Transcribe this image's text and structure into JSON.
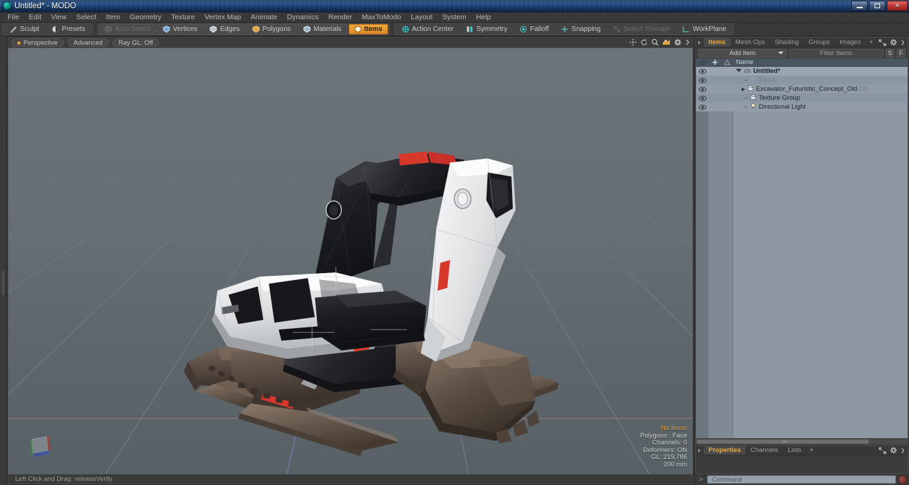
{
  "window": {
    "title": "Untitled* - MODO",
    "app_icon": "modo-orb-icon",
    "controls": {
      "minimize": "minimize-icon",
      "maximize": "maximize-icon",
      "close": "close-icon"
    }
  },
  "menubar": {
    "items": [
      {
        "label": "File"
      },
      {
        "label": "Edit"
      },
      {
        "label": "View"
      },
      {
        "label": "Select"
      },
      {
        "label": "Item"
      },
      {
        "label": "Geometry"
      },
      {
        "label": "Texture"
      },
      {
        "label": "Vertex Map"
      },
      {
        "label": "Animate"
      },
      {
        "label": "Dynamics"
      },
      {
        "label": "Render"
      },
      {
        "label": "MaxToModo"
      },
      {
        "label": "Layout"
      },
      {
        "label": "System"
      },
      {
        "label": "Help"
      }
    ]
  },
  "toolbar": {
    "group_left": [
      {
        "label": "Sculpt",
        "icon": "sculpt-icon",
        "state": "normal"
      },
      {
        "label": "Presets",
        "icon": "presets-icon",
        "state": "normal"
      }
    ],
    "group_mode": [
      {
        "label": "Auto Select",
        "icon": "auto-select-icon",
        "state": "disabled"
      },
      {
        "label": "Vertices",
        "icon": "vertices-icon",
        "state": "normal"
      },
      {
        "label": "Edges",
        "icon": "edges-icon",
        "state": "normal"
      },
      {
        "label": "Polygons",
        "icon": "polygons-icon",
        "state": "normal"
      },
      {
        "label": "Materials",
        "icon": "materials-icon",
        "state": "normal"
      },
      {
        "label": "Items",
        "icon": "items-icon",
        "state": "active"
      }
    ],
    "group_right": [
      {
        "label": "Action Center",
        "icon": "action-center-icon",
        "state": "normal"
      },
      {
        "label": "Symmetry",
        "icon": "symmetry-icon",
        "state": "normal"
      },
      {
        "label": "Falloff",
        "icon": "falloff-icon",
        "state": "normal"
      },
      {
        "label": "Snapping",
        "icon": "snapping-icon",
        "state": "normal"
      },
      {
        "label": "Select Through",
        "icon": "select-through-icon",
        "state": "disabled"
      },
      {
        "label": "WorkPlane",
        "icon": "workplane-icon",
        "state": "normal"
      }
    ]
  },
  "viewport": {
    "header": {
      "view_mode": "Perspective",
      "shading": "Advanced",
      "raygl": "Ray GL: Off",
      "controls": [
        "pan-icon",
        "rotate-icon",
        "zoom-icon",
        "fit-icon",
        "gear-icon",
        "chevron-right-icon"
      ]
    },
    "stats": {
      "selection": "No Items",
      "polygons": "Polygons : Face",
      "channels": "Channels: 0",
      "deformers": "Deformers: ON",
      "gl": "GL: 219,786",
      "grid_size": "200 mm"
    },
    "gizmo": "axis-gizmo",
    "statusbar": "Left Click and Drag:  releaseVerify",
    "scene_object": "Excavator_Futuristic_Concept_Old",
    "colors": {
      "bg_top": "#6b7479",
      "bg_bottom": "#586166",
      "axis_x": "#c85a5a",
      "axis_z": "#5a6ed2",
      "body_white": "#e8e9ea",
      "body_black": "#1d1d20",
      "accent_red": "#d8372b",
      "track_brown": "#6a5b50"
    }
  },
  "right_panel": {
    "top": {
      "tabs": [
        {
          "label": "Items",
          "active": true
        },
        {
          "label": "Mesh Ops",
          "active": false
        },
        {
          "label": "Shading",
          "active": false
        },
        {
          "label": "Groups",
          "active": false
        },
        {
          "label": "Images",
          "active": false
        },
        {
          "label": "+",
          "active": false
        }
      ],
      "tools": [
        "expand-icon",
        "gear-icon",
        "chevron-right-icon"
      ],
      "add_item_label": "Add Item",
      "filter_placeholder": "Filter Items",
      "buttons": [
        {
          "label": "S"
        },
        {
          "label": "F"
        }
      ],
      "list_header": "Name",
      "items": [
        {
          "name": "Untitled*",
          "count": "",
          "indent": 0,
          "disclosure": "open",
          "icon": "scene-icon",
          "bold": true,
          "dim": false
        },
        {
          "name": "Mesh",
          "count": "",
          "indent": 1,
          "disclosure": "dash",
          "icon": "mesh-icon",
          "bold": false,
          "dim": true
        },
        {
          "name": "Excavator_Futuristic_Concept_Old",
          "count": "(3)",
          "indent": 1,
          "disclosure": "closed",
          "icon": "mesh-icon",
          "bold": false,
          "dim": false
        },
        {
          "name": "Texture Group",
          "count": "",
          "indent": 1,
          "disclosure": "dash",
          "icon": "group-icon",
          "bold": false,
          "dim": false
        },
        {
          "name": "Directional Light",
          "count": "",
          "indent": 1,
          "disclosure": "dash",
          "icon": "light-icon",
          "bold": false,
          "dim": false
        }
      ]
    },
    "bottom": {
      "tabs": [
        {
          "label": "Properties",
          "active": true
        },
        {
          "label": "Channels",
          "active": false
        },
        {
          "label": "Lists",
          "active": false
        },
        {
          "label": "+",
          "active": false
        }
      ],
      "tools": [
        "expand-icon",
        "gear-icon",
        "chevron-right-icon"
      ]
    }
  },
  "command_bar": {
    "prompt": ">",
    "placeholder": "Command",
    "record_button": "record-icon"
  }
}
